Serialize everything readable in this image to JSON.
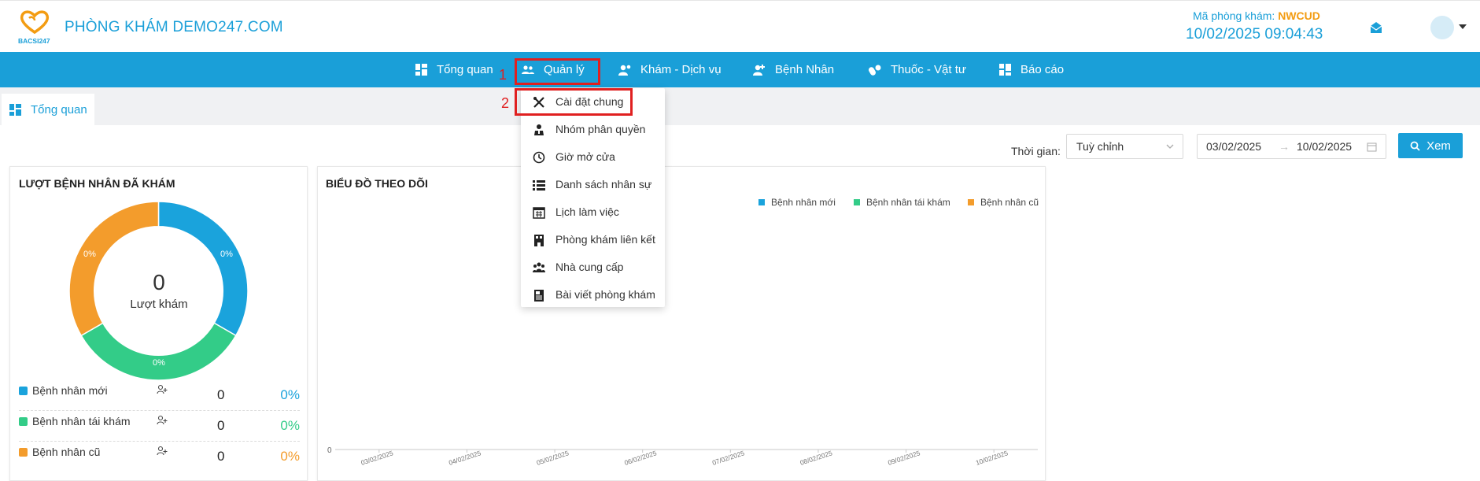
{
  "header": {
    "brand": "PHÒNG KHÁM DEMO247.COM",
    "logo_text": "BACSI247",
    "clinic_code_label": "Mã phòng khám:",
    "clinic_code": "NWCUD",
    "datetime": "10/02/2025 09:04:43"
  },
  "nav": {
    "items": [
      {
        "label": "Tổng quan",
        "icon": "dashboard-icon"
      },
      {
        "label": "Quản lý",
        "icon": "users-icon"
      },
      {
        "label": "Khám - Dịch vụ",
        "icon": "doctor-icon"
      },
      {
        "label": "Bệnh Nhân",
        "icon": "patient-icon"
      },
      {
        "label": "Thuốc - Vật tư",
        "icon": "pills-icon"
      },
      {
        "label": "Báo cáo",
        "icon": "report-icon"
      }
    ],
    "marker_1": "1",
    "marker_2": "2"
  },
  "tab": {
    "label": "Tổng quan"
  },
  "filter": {
    "label": "Thời gian:",
    "select_value": "Tuỳ chỉnh",
    "date_from": "03/02/2025",
    "date_sep": "→",
    "date_to": "10/02/2025",
    "button": "Xem"
  },
  "dropdown": {
    "items": [
      {
        "label": "Cài đặt chung",
        "icon": "tools-icon"
      },
      {
        "label": "Nhóm phân quyền",
        "icon": "user-tie-icon"
      },
      {
        "label": "Giờ mở cửa",
        "icon": "clock-icon"
      },
      {
        "label": "Danh sách nhân sự",
        "icon": "list-icon"
      },
      {
        "label": "Lịch làm việc",
        "icon": "calendar-icon"
      },
      {
        "label": "Phòng khám liên kết",
        "icon": "building-icon"
      },
      {
        "label": "Nhà cung cấp",
        "icon": "group-icon"
      },
      {
        "label": "Bài viết phòng khám",
        "icon": "article-icon"
      }
    ]
  },
  "visits_card": {
    "title": "LƯỢT BỆNH NHÂN ĐÃ KHÁM",
    "total": "0",
    "total_label": "Lượt khám",
    "slice_labels": [
      "0%",
      "0%",
      "0%"
    ],
    "rows": [
      {
        "label": "Bệnh nhân mới",
        "count": "0",
        "pct": "0%",
        "color": "#1aa3dc"
      },
      {
        "label": "Bệnh nhân tái khám",
        "count": "0",
        "pct": "0%",
        "color": "#33cc88"
      },
      {
        "label": "Bệnh nhân cũ",
        "count": "0",
        "pct": "0%",
        "color": "#f39c2c"
      }
    ]
  },
  "chart_card": {
    "title": "BIỂU ĐỒ THEO DÕI"
  },
  "chart_data": {
    "type": "line",
    "title": "BIỂU ĐỒ THEO DÕI",
    "x": [
      "03/02/2025",
      "04/02/2025",
      "05/02/2025",
      "06/02/2025",
      "07/02/2025",
      "08/02/2025",
      "09/02/2025",
      "10/02/2025"
    ],
    "series": [
      {
        "name": "Bệnh nhân mới",
        "values": [
          0,
          0,
          0,
          0,
          0,
          0,
          0,
          0
        ],
        "color": "#1aa3dc"
      },
      {
        "name": "Bệnh nhân tái khám",
        "values": [
          0,
          0,
          0,
          0,
          0,
          0,
          0,
          0
        ],
        "color": "#33cc88"
      },
      {
        "name": "Bệnh nhân cũ",
        "values": [
          0,
          0,
          0,
          0,
          0,
          0,
          0,
          0
        ],
        "color": "#f39c2c"
      }
    ],
    "y_tick_labels": [
      "0"
    ],
    "legend": "top-right"
  }
}
